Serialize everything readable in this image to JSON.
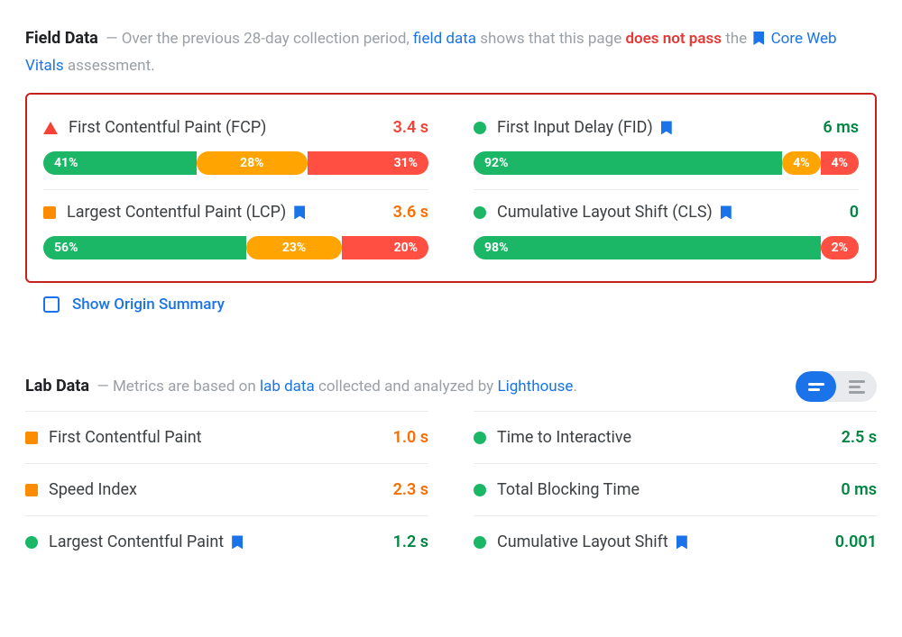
{
  "field": {
    "title": "Field Data",
    "intro_1": "— Over the previous 28-day collection period,",
    "link_field_data": "field data",
    "intro_2": "shows that this page",
    "fail_text": "does not pass",
    "intro_3": "the",
    "link_cwv": "Core Web Vitals",
    "intro_4": "assessment.",
    "metrics": [
      {
        "icon": "tri",
        "label": "First Contentful Paint (FCP)",
        "bookmark": false,
        "value": "3.4 s",
        "vclass": "v-red",
        "dist": {
          "g": 41,
          "o": 28,
          "r": 31
        }
      },
      {
        "icon": "circ",
        "label": "First Input Delay (FID)",
        "bookmark": true,
        "value": "6 ms",
        "vclass": "v-green",
        "dist": {
          "g": 92,
          "o": 4,
          "r": 4
        }
      },
      {
        "icon": "sq",
        "label": "Largest Contentful Paint (LCP)",
        "bookmark": true,
        "value": "3.6 s",
        "vclass": "v-orange",
        "dist": {
          "g": 56,
          "o": 23,
          "r": 20
        }
      },
      {
        "icon": "circ",
        "label": "Cumulative Layout Shift (CLS)",
        "bookmark": true,
        "value": "0",
        "vclass": "v-green",
        "dist": {
          "g": 98,
          "o": 0,
          "r": 2
        }
      }
    ],
    "show_origin": "Show Origin Summary"
  },
  "lab": {
    "title": "Lab Data",
    "intro_1": "— Metrics are based on",
    "link_lab": "lab data",
    "intro_2": "collected and analyzed by",
    "link_lh": "Lighthouse",
    "intro_3": ".",
    "metrics": [
      {
        "icon": "sq",
        "label": "First Contentful Paint",
        "bookmark": false,
        "value": "1.0 s",
        "vclass": "v-orange"
      },
      {
        "icon": "circ",
        "label": "Time to Interactive",
        "bookmark": false,
        "value": "2.5 s",
        "vclass": "v-green"
      },
      {
        "icon": "sq",
        "label": "Speed Index",
        "bookmark": false,
        "value": "2.3 s",
        "vclass": "v-orange"
      },
      {
        "icon": "circ",
        "label": "Total Blocking Time",
        "bookmark": false,
        "value": "0 ms",
        "vclass": "v-green"
      },
      {
        "icon": "circ",
        "label": "Largest Contentful Paint",
        "bookmark": true,
        "value": "1.2 s",
        "vclass": "v-green"
      },
      {
        "icon": "circ",
        "label": "Cumulative Layout Shift",
        "bookmark": true,
        "value": "0.001",
        "vclass": "v-green"
      }
    ]
  }
}
